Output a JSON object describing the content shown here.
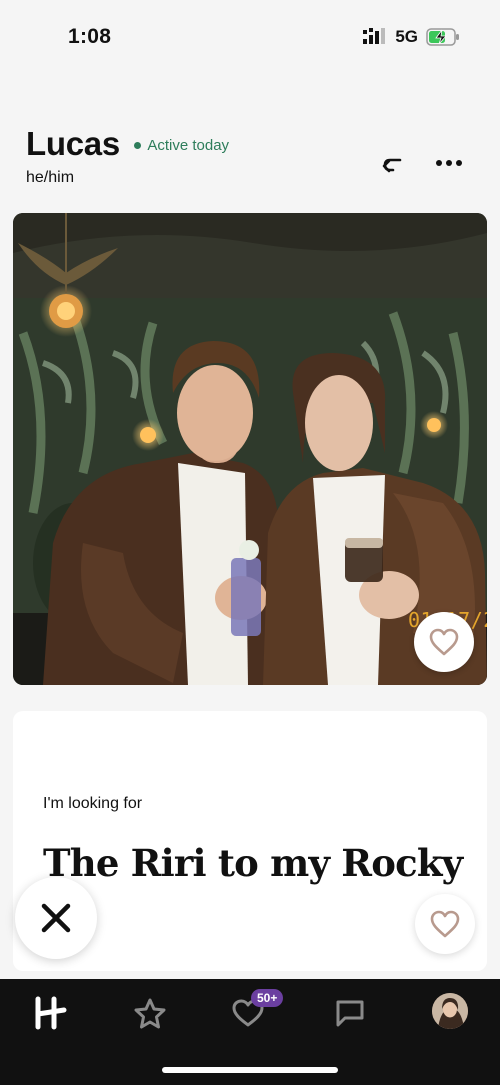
{
  "status_bar": {
    "time": "1:08",
    "network": "5G"
  },
  "profile": {
    "name": "Lucas",
    "active_status": "Active today",
    "pronouns": "he/him"
  },
  "photo": {
    "date_stamp": "01/17/2"
  },
  "prompt": {
    "question": "I'm looking for",
    "answer": "The Riri to my Rocky"
  },
  "nav": {
    "likes_badge": "50+"
  },
  "colors": {
    "active_green": "#2e7d5b",
    "badge_purple": "#6b3fa0",
    "nav_background": "#111111",
    "page_background": "#f5f5f5",
    "heart_outline": "#b89a8e"
  },
  "icons": {
    "share": "share-arrow-icon",
    "more": "more-dots-icon",
    "like": "heart-icon",
    "skip": "x-icon",
    "home": "hinge-logo-icon",
    "standouts": "star-icon",
    "likes_you": "heart-icon",
    "matches": "chat-bubble-icon"
  }
}
